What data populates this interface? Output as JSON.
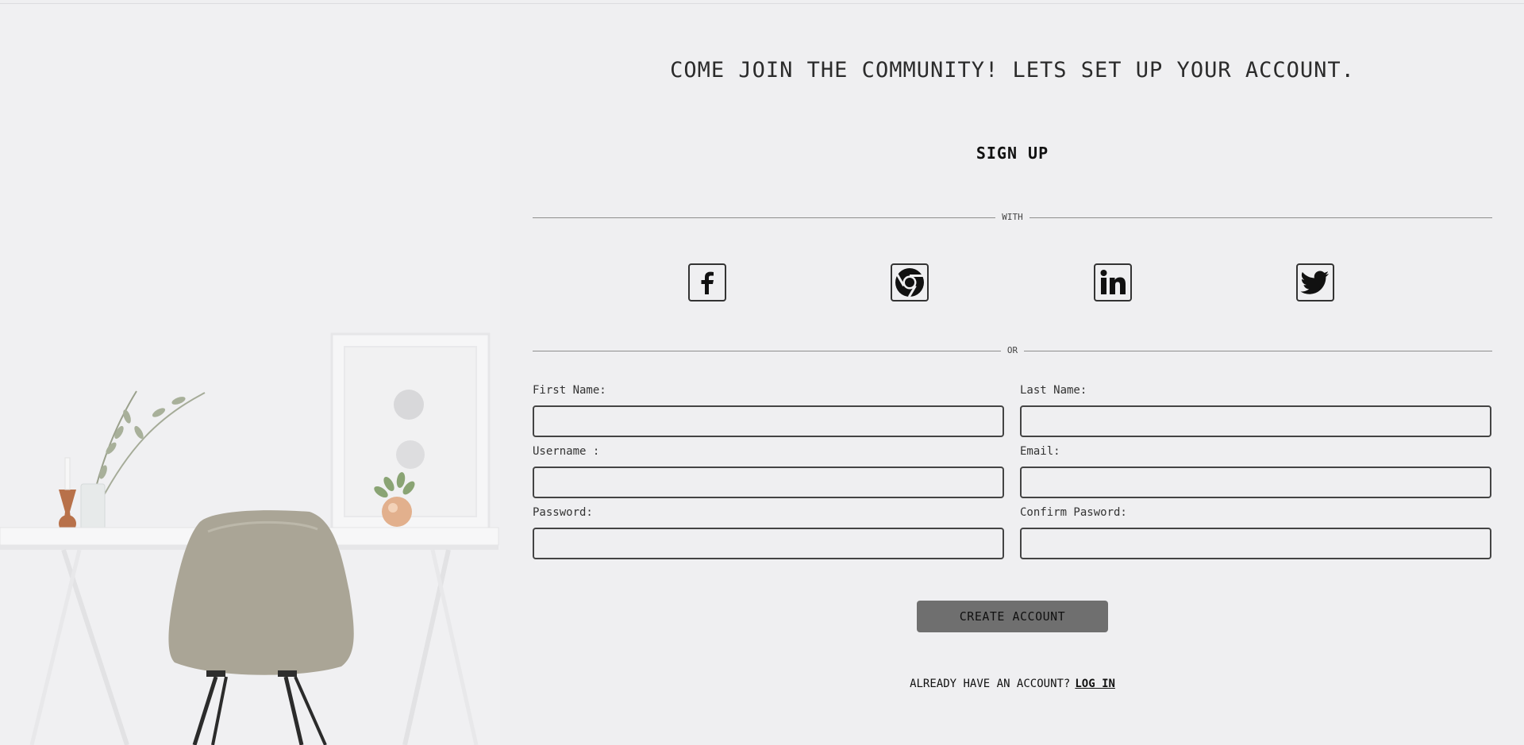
{
  "header": {
    "tagline": "COME JOIN THE COMMUNITY! LETS SET UP YOUR ACCOUNT.",
    "title": "SIGN UP"
  },
  "dividers": {
    "with": "WITH",
    "or": "OR"
  },
  "socials": [
    {
      "name": "facebook",
      "icon": "facebook-icon"
    },
    {
      "name": "google",
      "icon": "chrome-icon"
    },
    {
      "name": "linkedin",
      "icon": "linkedin-icon"
    },
    {
      "name": "twitter",
      "icon": "twitter-icon"
    }
  ],
  "form": {
    "first_name_label": "First Name:",
    "last_name_label": "Last Name:",
    "username_label": "Username :",
    "email_label": "Email:",
    "password_label": "Password:",
    "confirm_password_label": "Confirm Pasword:",
    "first_name_value": "",
    "last_name_value": "",
    "username_value": "",
    "email_value": "",
    "password_value": "",
    "confirm_password_value": "",
    "submit_label": "CREATE ACCOUNT"
  },
  "footer": {
    "prompt": "ALREADY HAVE AN ACCOUNT?",
    "login_link": "LOG IN"
  },
  "colors": {
    "background": "#efeff1",
    "button": "#6f6f6f",
    "border": "#444444"
  }
}
